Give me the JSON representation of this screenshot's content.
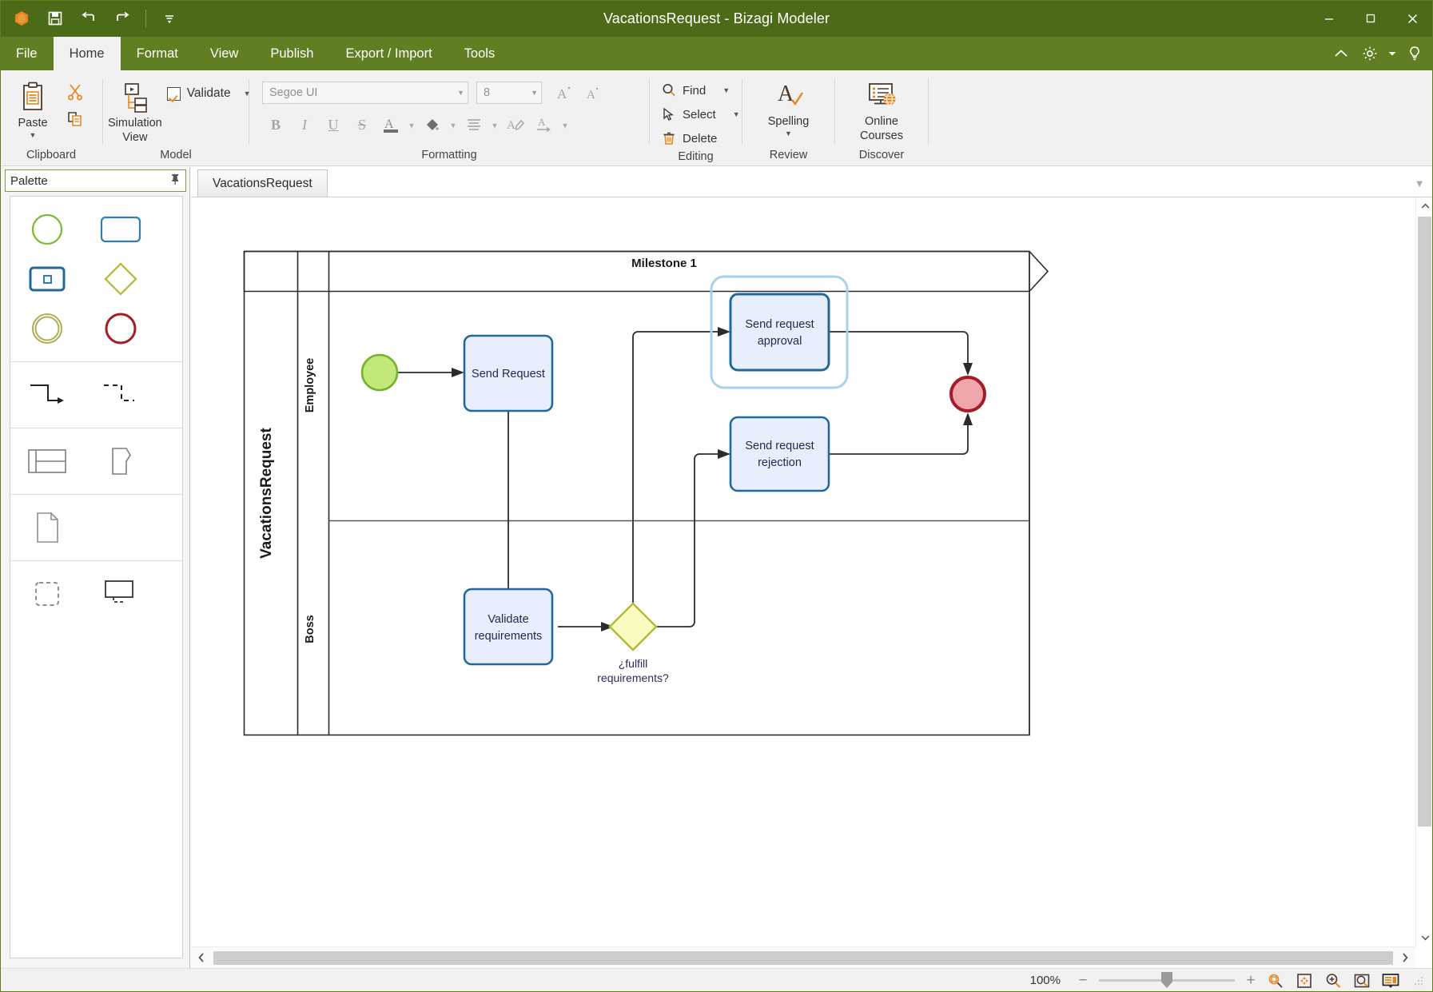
{
  "window": {
    "title": "VacationsRequest - Bizagi Modeler",
    "quick_access": [
      {
        "name": "app-logo-icon",
        "label": "Bizagi"
      },
      {
        "name": "save-icon",
        "label": "Save"
      },
      {
        "name": "undo-icon",
        "label": "Undo"
      },
      {
        "name": "redo-icon",
        "label": "Redo"
      },
      {
        "name": "customize-quick-access-icon",
        "label": "Customize Quick Access Toolbar"
      }
    ],
    "controls": [
      {
        "name": "minimize-button",
        "label": "Minimize"
      },
      {
        "name": "maximize-button",
        "label": "Maximize"
      },
      {
        "name": "close-button",
        "label": "Close"
      }
    ]
  },
  "menu": {
    "tabs": [
      {
        "label": "File",
        "active": false
      },
      {
        "label": "Home",
        "active": true
      },
      {
        "label": "Format",
        "active": false
      },
      {
        "label": "View",
        "active": false
      },
      {
        "label": "Publish",
        "active": false
      },
      {
        "label": "Export / Import",
        "active": false
      },
      {
        "label": "Tools",
        "active": false
      }
    ],
    "right_icons": [
      {
        "name": "collapse-ribbon-icon",
        "label": "Collapse Ribbon"
      },
      {
        "name": "settings-gear-icon",
        "label": "Settings"
      },
      {
        "name": "settings-dropdown-caret-icon",
        "label": "Settings menu"
      },
      {
        "name": "lightbulb-help-icon",
        "label": "Tips"
      }
    ]
  },
  "ribbon": {
    "groups": [
      {
        "label": "Clipboard"
      },
      {
        "label": "Model"
      },
      {
        "label": "Formatting"
      },
      {
        "label": "Editing"
      },
      {
        "label": "Review"
      },
      {
        "label": "Discover"
      }
    ],
    "clipboard": {
      "paste_label": "Paste",
      "cut_label": "Cut",
      "copy_label": "Copy"
    },
    "model": {
      "simulation_view_label": "Simulation\nView",
      "simulation_line1": "Simulation",
      "simulation_line2": "View",
      "validate_label": "Validate",
      "validate_checked": true
    },
    "formatting": {
      "font_family": "Segoe UI",
      "font_size": "8",
      "bold_label": "B",
      "italic_label": "I",
      "underline_label": "U",
      "strikethrough_label": "S",
      "font_color_label": "A",
      "fill_color_label": "Fill",
      "align_label": "Align",
      "grow_font_label": "A",
      "shrink_font_label": "A",
      "highlight_label": "Highlight",
      "text_direction_label": "A"
    },
    "editing": {
      "find_label": "Find",
      "select_label": "Select",
      "delete_label": "Delete"
    },
    "review": {
      "spelling_label": "Spelling"
    },
    "discover": {
      "online_line1": "Online",
      "online_line2": "Courses"
    }
  },
  "palette": {
    "title": "Palette",
    "pin_label": "Pin",
    "sections": [
      {
        "name": "events-activities",
        "items": [
          {
            "name": "start-event-shape",
            "label": "Start event"
          },
          {
            "name": "task-shape",
            "label": "Task"
          },
          {
            "name": "sub-process-shape",
            "label": "Sub-process"
          },
          {
            "name": "gateway-shape",
            "label": "Gateway"
          },
          {
            "name": "intermediate-event-shape",
            "label": "Intermediate event"
          },
          {
            "name": "end-event-shape",
            "label": "End event"
          }
        ]
      },
      {
        "name": "connectors",
        "items": [
          {
            "name": "sequence-flow-shape",
            "label": "Sequence flow"
          },
          {
            "name": "message-flow-shape",
            "label": "Message flow"
          }
        ]
      },
      {
        "name": "containers",
        "items": [
          {
            "name": "pool-shape",
            "label": "Pool"
          },
          {
            "name": "milestone-shape",
            "label": "Milestone"
          }
        ]
      },
      {
        "name": "artifacts",
        "items": [
          {
            "name": "data-object-shape",
            "label": "Data object"
          }
        ]
      },
      {
        "name": "annotations",
        "items": [
          {
            "name": "group-shape",
            "label": "Group"
          },
          {
            "name": "annotation-shape",
            "label": "Annotation"
          }
        ]
      }
    ]
  },
  "document_tabs": {
    "tabs": [
      {
        "label": "VacationsRequest",
        "active": true
      }
    ],
    "overflow_caret": "▼"
  },
  "diagram": {
    "pool_name": "VacationsRequest",
    "milestone_label": "Milestone 1",
    "lanes": [
      {
        "name": "Employee"
      },
      {
        "name": "Boss"
      }
    ],
    "nodes": [
      {
        "id": "start",
        "type": "start-event",
        "label": "",
        "lane": "Employee"
      },
      {
        "id": "send-request",
        "type": "task",
        "label": "Send Request",
        "lane": "Employee"
      },
      {
        "id": "send-request-approval",
        "type": "task",
        "label": "Send request approval",
        "label_line1": "Send request",
        "label_line2": "approval",
        "lane": "Employee",
        "selected": true
      },
      {
        "id": "send-request-rejection",
        "type": "task",
        "label": "Send request rejection",
        "label_line1": "Send request",
        "label_line2": "rejection",
        "lane": "Employee",
        "selected": false
      },
      {
        "id": "end",
        "type": "end-event",
        "label": "",
        "lane": "Employee"
      },
      {
        "id": "validate-requirements",
        "type": "task",
        "label": "Validate requirements",
        "label_line1": "Validate",
        "label_line2": "requirements",
        "lane": "Boss"
      },
      {
        "id": "fulfill-gateway",
        "type": "gateway",
        "label": "¿fulfill requirements?",
        "label_line1": "¿fulfill",
        "label_line2": "requirements?",
        "lane": "Boss"
      }
    ],
    "colors": {
      "task_fill": "#e8eefc",
      "task_stroke": "#1f6a98",
      "start_fill": "#c2e87a",
      "start_stroke": "#74b32c",
      "end_fill": "#efa7ab",
      "end_stroke": "#a51b28",
      "gateway_fill": "#fbfbc0",
      "gateway_stroke": "#b8b832",
      "selection": "#a9d2e8",
      "flow": "#2b2b2b"
    }
  },
  "status": {
    "zoom_level": "100%",
    "zoom_out_label": "−",
    "zoom_in_label": "+",
    "buttons": [
      {
        "name": "zoom-to-selection-icon",
        "label": "Zoom to selection"
      },
      {
        "name": "fit-to-window-icon",
        "label": "Fit to window"
      },
      {
        "name": "zoom-in-icon",
        "label": "Zoom in"
      },
      {
        "name": "zoom-region-icon",
        "label": "Zoom region"
      },
      {
        "name": "presentation-mode-icon",
        "label": "Presentation mode"
      }
    ]
  }
}
